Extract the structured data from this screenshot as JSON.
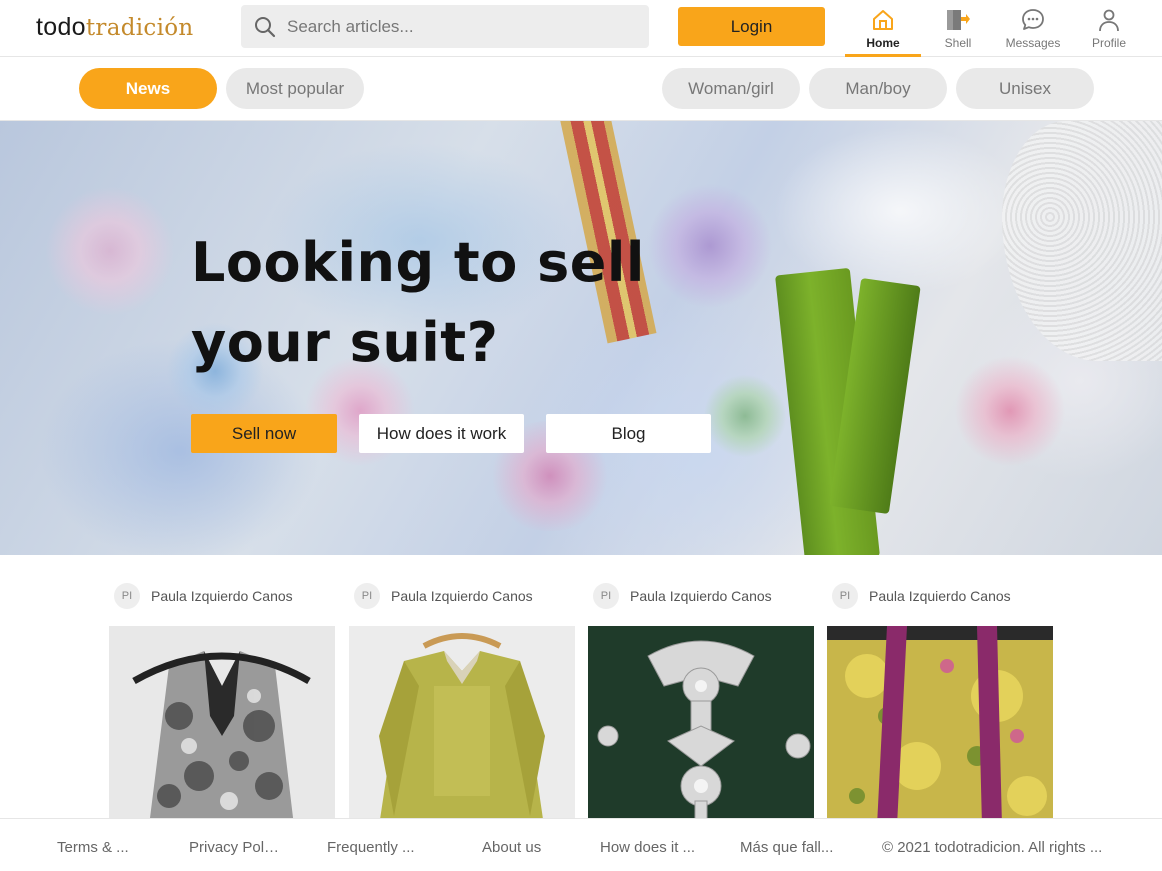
{
  "header": {
    "logo_part1": "todo",
    "logo_part2": "tradición",
    "search_placeholder": "Search articles...",
    "login_label": "Login",
    "nav": [
      {
        "label": "Home",
        "icon": "home-icon",
        "active": true
      },
      {
        "label": "Shell",
        "icon": "shell-icon",
        "active": false
      },
      {
        "label": "Messages",
        "icon": "messages-icon",
        "active": false
      },
      {
        "label": "Profile",
        "icon": "profile-icon",
        "active": false
      }
    ]
  },
  "filters": {
    "left": [
      {
        "label": "News",
        "active": true
      },
      {
        "label": "Most popular",
        "active": false
      }
    ],
    "right": [
      {
        "label": "Woman/girl"
      },
      {
        "label": "Man/boy"
      },
      {
        "label": "Unisex"
      }
    ]
  },
  "hero": {
    "title": "Looking to sell your suit?",
    "buttons": [
      {
        "label": "Sell now"
      },
      {
        "label": "How does it work"
      },
      {
        "label": "Blog"
      }
    ]
  },
  "cards": [
    {
      "initials": "PI",
      "author": "Paula Izquierdo Canos",
      "photo": "silver-brocade-vest"
    },
    {
      "initials": "PI",
      "author": "Paula Izquierdo Canos",
      "photo": "green-silk-jacket"
    },
    {
      "initials": "PI",
      "author": "Paula Izquierdo Canos",
      "photo": "silver-brooch-jewelry"
    },
    {
      "initials": "PI",
      "author": "Paula Izquierdo Canos",
      "photo": "yellow-floral-skirt"
    }
  ],
  "footer": {
    "links": [
      "Terms & ...",
      "Privacy Policy",
      "Frequently ...",
      "About us",
      "How does it ...",
      "Más que fall...",
      "© 2021 todotradicion. All rights ..."
    ]
  },
  "colors": {
    "accent": "#f9a51a",
    "logo_tradicion": "#c48a2c",
    "pill_bg": "#e9e9e9"
  }
}
